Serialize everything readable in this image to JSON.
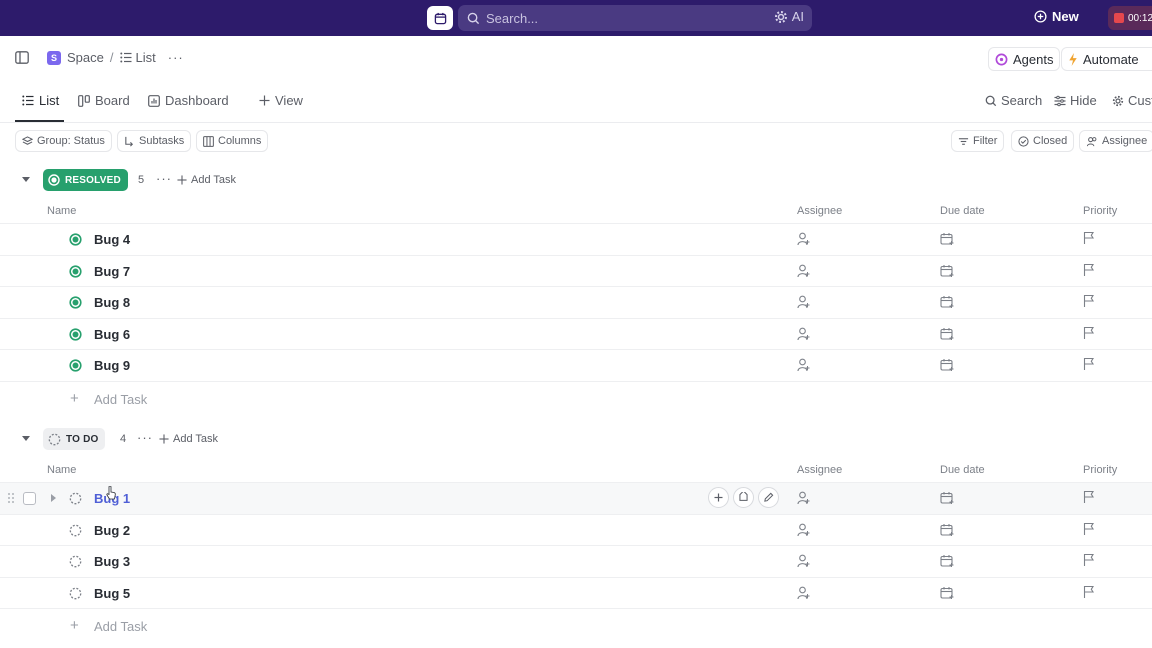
{
  "topbar": {
    "search_placeholder": "Search...",
    "ai_label": "AI",
    "new_label": "New",
    "timer_text": "00:12"
  },
  "breadcrumb": {
    "space_initial": "S",
    "space_label": "Space",
    "separator": "/",
    "list_label": "List",
    "more": "···"
  },
  "header_actions": {
    "agents_label": "Agents",
    "automate_label": "Automate"
  },
  "view_tabs": {
    "tabs": [
      {
        "label": "List",
        "icon": "list-icon",
        "active": true
      },
      {
        "label": "Board",
        "icon": "board-icon",
        "active": false
      },
      {
        "label": "Dashboard",
        "icon": "dashboard-icon",
        "active": false
      }
    ],
    "add_view_label": "View",
    "search_label": "Search",
    "hide_label": "Hide",
    "customize_label": "Cust"
  },
  "filters": {
    "group_label": "Group: Status",
    "subtasks_label": "Subtasks",
    "columns_label": "Columns",
    "filter_label": "Filter",
    "closed_label": "Closed",
    "assignee_label": "Assignee"
  },
  "columns": {
    "name": "Name",
    "assignee": "Assignee",
    "due_date": "Due date",
    "priority": "Priority"
  },
  "groups": [
    {
      "status": "RESOLVED",
      "count": "5",
      "more": "···",
      "add_label": "Add Task",
      "color": "#27a06d",
      "tasks": [
        "Bug 4",
        "Bug 7",
        "Bug 8",
        "Bug 6",
        "Bug 9"
      ],
      "add_row_label": "Add Task"
    },
    {
      "status": "TO DO",
      "count": "4",
      "more": "···",
      "add_label": "Add Task",
      "color": "#eeeff1",
      "tasks": [
        "Bug 1",
        "Bug 2",
        "Bug 3",
        "Bug 5"
      ],
      "add_row_label": "Add Task"
    }
  ],
  "colors": {
    "topbar_bg": "#2d1b6b",
    "accent": "#7b68ee",
    "resolved": "#27a06d",
    "link": "#4f5fd6"
  }
}
